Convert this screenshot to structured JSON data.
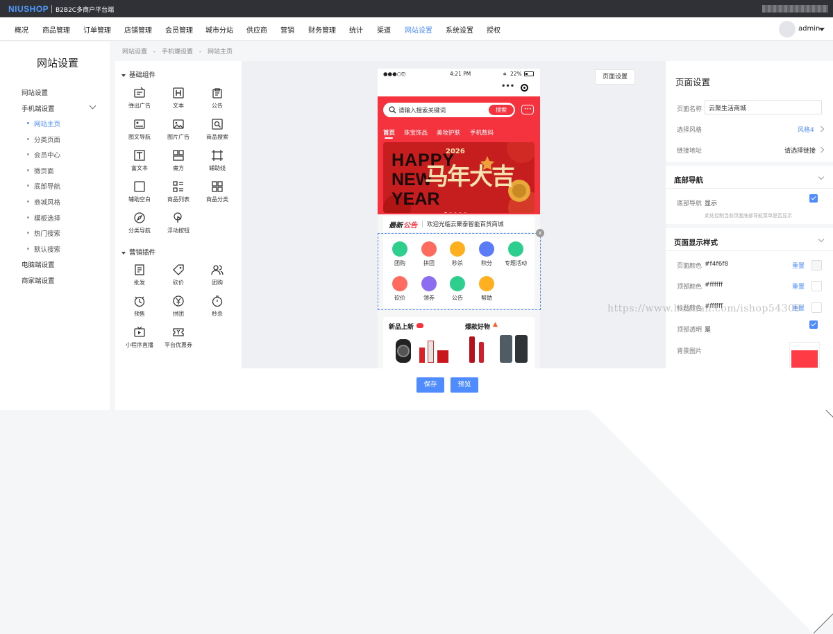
{
  "topbar": {
    "logo": "NIUSHOP",
    "platform": "B2B2C多商户平台端"
  },
  "nav": {
    "items": [
      "概况",
      "商品管理",
      "订单管理",
      "店铺管理",
      "会员管理",
      "城市分站",
      "供应商",
      "营销",
      "财务管理",
      "统计",
      "渠道",
      "网站设置",
      "系统设置",
      "授权"
    ],
    "active_index": 11,
    "user": "admin"
  },
  "sidebar": {
    "title": "网站设置",
    "items": [
      {
        "label": "网站设置"
      },
      {
        "label": "手机端设置"
      },
      {
        "label": "电脑端设置"
      },
      {
        "label": "商家端设置"
      }
    ],
    "sub_items": [
      "网站主页",
      "分类页面",
      "会员中心",
      "微页面",
      "底部导航",
      "商城风格",
      "模板选择",
      "热门搜索",
      "默认搜索"
    ]
  },
  "breadcrumb": [
    "网站设置",
    "-",
    "手机端设置",
    "-",
    "网站主页"
  ],
  "components": {
    "basic_title": "基础组件",
    "basic": [
      "弹出广告",
      "文本",
      "公告",
      "图文导航",
      "图片广告",
      "商品搜索",
      "富文本",
      "魔方",
      "辅助线",
      "辅助空白",
      "商品列表",
      "商品分类",
      "分类导航",
      "浮动按钮"
    ],
    "marketing_title": "营销插件",
    "marketing": [
      "批发",
      "砍价",
      "团购",
      "预售",
      "拼团",
      "秒杀",
      "小程序直播",
      "平台优惠券"
    ]
  },
  "canvas": {
    "page_settings_button": "页面设置"
  },
  "phone": {
    "status_left": "●●●○○",
    "status_time": "4:21 PM",
    "status_battery": "22%",
    "search_placeholder": "请输入搜索关键词",
    "search_button": "搜索",
    "categories": [
      "首页",
      "珠宝饰品",
      "美妆护肤",
      "手机数码"
    ],
    "banner_line1": "HAPPY",
    "banner_line2": "NEW",
    "banner_line3": "YEAR",
    "banner_cn": "马年大吉",
    "banner_year": "2026",
    "notice_tag1": "最新",
    "notice_tag2": "公告",
    "notice_text": "欢迎光临云聚泰智能百货商城",
    "nav_icons": [
      {
        "label": "团购",
        "color": "#2ecf8e"
      },
      {
        "label": "拼团",
        "color": "#ff6b5e"
      },
      {
        "label": "秒杀",
        "color": "#ffb020"
      },
      {
        "label": "积分",
        "color": "#5b7cf6"
      },
      {
        "label": "专题活动",
        "color": "#2ecf8e"
      },
      {
        "label": "砍价",
        "color": "#ff6b5e"
      },
      {
        "label": "领券",
        "color": "#8c6cf0"
      },
      {
        "label": "公告",
        "color": "#2ecf8e"
      },
      {
        "label": "帮助",
        "color": "#ffb020"
      }
    ],
    "close": "x",
    "new_goods": "新品上新",
    "hot_goods": "爆款好物"
  },
  "right": {
    "title": "页面设置",
    "page_name_label": "页面名称",
    "page_name_value": "云聚生活商城",
    "style_label": "选择风格",
    "style_value": "风格4",
    "link_label": "链接地址",
    "link_value": "请选择链接",
    "bottom_nav_section": "底部导航",
    "bottom_nav_label": "底部导航",
    "bottom_nav_value": "显示",
    "bottom_nav_hint": "此处控制当前页面底部导航菜单是否显示",
    "display_section": "页面显示样式",
    "page_color_label": "页面颜色",
    "page_color_value": "#f4f6f8",
    "top_color_label": "顶部颜色",
    "top_color_value": "#ffffff",
    "title_color_label": "标题颜色",
    "title_color_value": "#ffffff",
    "reset": "重置",
    "top_transparent_label": "顶部透明",
    "top_transparent_value": "是",
    "bg_image_label": "背景图片",
    "accent": "#4e8cff",
    "bg_swatch": "#ff3b45"
  },
  "footer": {
    "save": "保存",
    "preview": "预览"
  },
  "watermark": "https://www.huzhan.com/ishop54309"
}
